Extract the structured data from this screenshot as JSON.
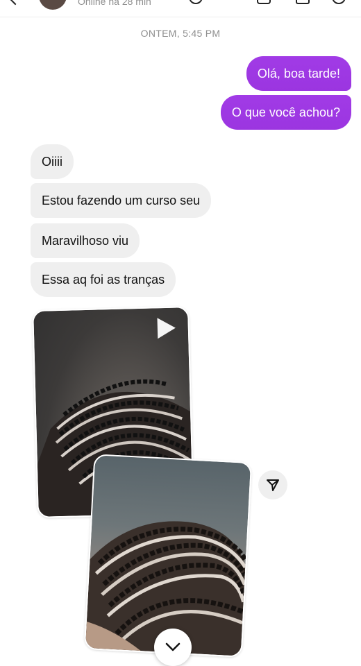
{
  "header": {
    "status": "Online há 28 min"
  },
  "timestamp": "ONTEM, 5:45 PM",
  "messages_out": [
    "Olá, boa tarde!",
    "O que você achou?"
  ],
  "messages_in": [
    "Oiiii",
    "Estou fazendo um curso seu",
    "Maravilhoso viu",
    "Essa aq foi as tranças"
  ],
  "icons": {
    "back": "chevron-left-icon",
    "play": "play-icon",
    "share": "send-icon",
    "scroll": "chevron-down-icon"
  },
  "colors": {
    "outgoing_bubble": "#9b35e0",
    "incoming_bubble": "#efefef",
    "timestamp_text": "#8e8e8e"
  }
}
